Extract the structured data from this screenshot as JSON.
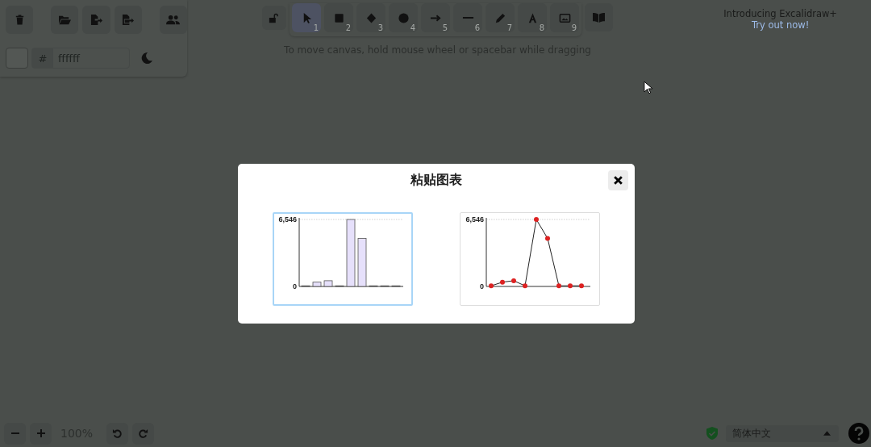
{
  "background_panel": {
    "prefix": "#",
    "value": "ffffff"
  },
  "tools": [
    {
      "kind": "selection",
      "shortcut": "1",
      "selected": true
    },
    {
      "kind": "rectangle",
      "shortcut": "2",
      "selected": false
    },
    {
      "kind": "diamond",
      "shortcut": "3",
      "selected": false
    },
    {
      "kind": "ellipse",
      "shortcut": "4",
      "selected": false
    },
    {
      "kind": "arrow",
      "shortcut": "5",
      "selected": false
    },
    {
      "kind": "line",
      "shortcut": "6",
      "selected": false
    },
    {
      "kind": "pencil",
      "shortcut": "7",
      "selected": false
    },
    {
      "kind": "text",
      "shortcut": "8",
      "selected": false
    },
    {
      "kind": "image",
      "shortcut": "9",
      "selected": false
    }
  ],
  "hint": "To move canvas, hold mouse wheel or spacebar while dragging",
  "promo": {
    "title": "Introducing Excalidraw+",
    "link": "Try out now!"
  },
  "dialog": {
    "title": "粘贴图表",
    "charts": [
      {
        "selected": true,
        "chart_data": {
          "type": "bar",
          "ylim": [
            0,
            6546
          ],
          "yticks": [
            0,
            {
              "value": 6546,
              "label": "6,546"
            }
          ],
          "values": [
            60,
            420,
            560,
            60,
            6546,
            4700,
            60,
            60,
            60
          ]
        }
      },
      {
        "selected": false,
        "chart_data": {
          "type": "line",
          "marker": "circle",
          "ylim": [
            0,
            6546
          ],
          "yticks": [
            0,
            {
              "value": 6546,
              "label": "6,546"
            }
          ],
          "values": [
            60,
            420,
            560,
            60,
            6546,
            4700,
            60,
            60,
            60
          ]
        }
      }
    ]
  },
  "zoom": {
    "level_text": "100%"
  },
  "language": {
    "value": "简体中文"
  }
}
